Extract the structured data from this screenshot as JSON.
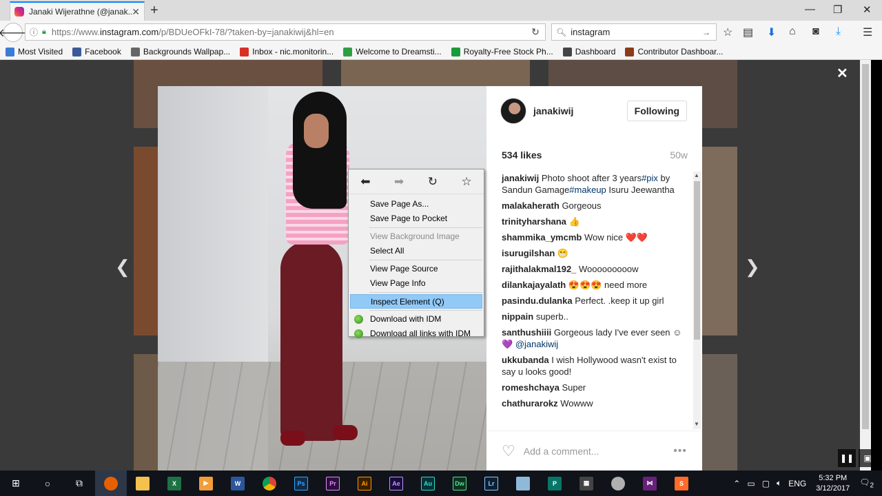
{
  "browser": {
    "tab_title": "Janaki Wijerathne (@janak...",
    "url_prefix": "https://www.",
    "url_host": "instagram.com",
    "url_path": "/p/BDUeOFkI-78/?taken-by=janakiwij&hl=en",
    "search_query": "instagram",
    "bookmarks": [
      {
        "label": "Most Visited",
        "color": "#3b7bd6"
      },
      {
        "label": "Facebook",
        "color": "#3b5998"
      },
      {
        "label": "Backgrounds Wallpap...",
        "color": "#666666"
      },
      {
        "label": "Inbox - nic.monitorin...",
        "color": "#d93025"
      },
      {
        "label": "Welcome to Dreamsti...",
        "color": "#2e9e44"
      },
      {
        "label": "Royalty-Free Stock Ph...",
        "color": "#1a9b3c"
      },
      {
        "label": "Dashboard",
        "color": "#444444"
      },
      {
        "label": "Contributor Dashboar...",
        "color": "#8b3a1a"
      }
    ]
  },
  "post": {
    "username": "janakiwij",
    "follow_label": "Following",
    "likes": "534 likes",
    "age": "50w",
    "caption": {
      "user": "janakiwij",
      "text1": " Photo shoot after 3 years",
      "tag1": "#pix",
      "text2": " by Sandun Gamage",
      "tag2": "#makeup",
      "text3": " Isuru Jeewantha"
    },
    "comments": [
      {
        "user": "malakaherath",
        "text": " Gorgeous"
      },
      {
        "user": "trinityharshana",
        "text": " 👍"
      },
      {
        "user": "shammika_ymcmb",
        "text": " Wow nice ❤️❤️"
      },
      {
        "user": "isurugilshan",
        "text": " 😁"
      },
      {
        "user": "rajithalakmal192_",
        "text": " Wooooooooow"
      },
      {
        "user": "dilankajayalath",
        "text": " 😍😍😍 need more"
      },
      {
        "user": "pasindu.dulanka",
        "text": " Perfect. .keep it up girl"
      },
      {
        "user": "nippain",
        "text": " superb.."
      },
      {
        "user": "santhushiiii",
        "text": " Gorgeous lady I've ever seen ☺💜 ",
        "tag": "@janakiwij"
      },
      {
        "user": "ukkubanda",
        "text": " I wish Hollywood wasn't exist to say u looks good!"
      },
      {
        "user": "romeshchaya",
        "text": " Super"
      },
      {
        "user": "chathurarokz",
        "text": " Wowww"
      }
    ],
    "add_comment_placeholder": "Add a comment..."
  },
  "context_menu": {
    "items": [
      {
        "label": "Save Page As...",
        "disabled": false
      },
      {
        "label": "Save Page to Pocket",
        "disabled": false
      },
      {
        "label": "View Background Image",
        "disabled": true
      },
      {
        "label": "Select All",
        "disabled": false
      },
      {
        "label": "View Page Source",
        "disabled": false
      },
      {
        "label": "View Page Info",
        "disabled": false
      },
      {
        "label": "Inspect Element (Q)",
        "disabled": false
      },
      {
        "label": "Download with IDM",
        "disabled": false
      },
      {
        "label": "Download all links with IDM",
        "disabled": false
      }
    ]
  },
  "taskbar": {
    "apps": [
      {
        "name": "Ps",
        "color": "#0f2b4a",
        "fg": "#31a8ff"
      },
      {
        "name": "Pr",
        "color": "#2a0f3c",
        "fg": "#e28bff"
      },
      {
        "name": "Ai",
        "color": "#3a1e00",
        "fg": "#ff9a00"
      },
      {
        "name": "Ae",
        "color": "#1c0b3b",
        "fg": "#b59dff"
      },
      {
        "name": "Au",
        "color": "#07323a",
        "fg": "#2fe0c4"
      },
      {
        "name": "Dw",
        "color": "#0b3320",
        "fg": "#59e08c"
      },
      {
        "name": "Lr",
        "color": "#0c2033",
        "fg": "#8ec9ff"
      }
    ],
    "lang": "ENG",
    "time": "5:32 PM",
    "date": "3/12/2017",
    "notifications": "2"
  }
}
